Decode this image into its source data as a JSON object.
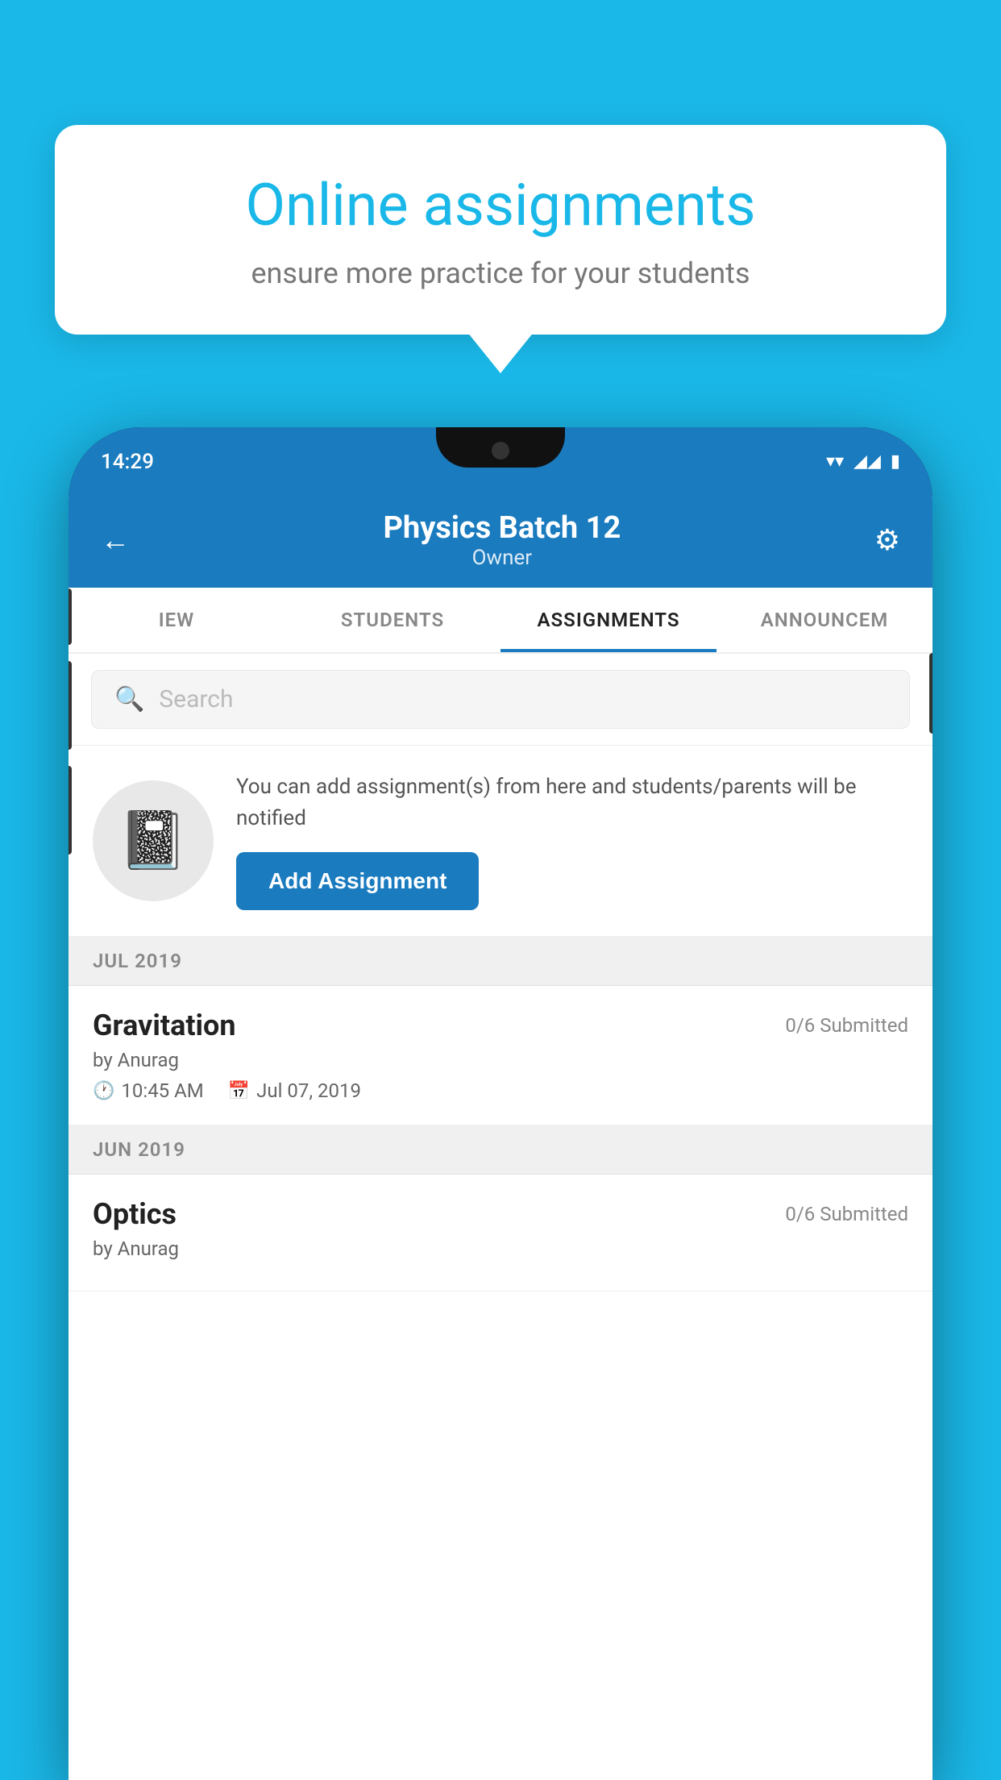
{
  "background": {
    "color": "#1ab8e8"
  },
  "speech_bubble": {
    "title": "Online assignments",
    "subtitle": "ensure more practice for your students"
  },
  "phone": {
    "status_bar": {
      "time": "14:29",
      "wifi": "▼",
      "signal": "▲",
      "battery": "▮"
    },
    "header": {
      "title": "Physics Batch 12",
      "subtitle": "Owner",
      "back_label": "←",
      "settings_label": "⚙"
    },
    "tabs": [
      {
        "label": "IEW",
        "active": false
      },
      {
        "label": "STUDENTS",
        "active": false
      },
      {
        "label": "ASSIGNMENTS",
        "active": true
      },
      {
        "label": "ANNOUNCEM",
        "active": false
      }
    ],
    "search": {
      "placeholder": "Search"
    },
    "add_section": {
      "description": "You can add assignment(s) from here and students/parents will be notified",
      "button_label": "Add Assignment"
    },
    "assignment_groups": [
      {
        "month": "JUL 2019",
        "assignments": [
          {
            "name": "Gravitation",
            "submitted": "0/6 Submitted",
            "by": "by Anurag",
            "time": "10:45 AM",
            "date": "Jul 07, 2019"
          }
        ]
      },
      {
        "month": "JUN 2019",
        "assignments": [
          {
            "name": "Optics",
            "submitted": "0/6 Submitted",
            "by": "by Anurag",
            "time": "",
            "date": ""
          }
        ]
      }
    ]
  }
}
